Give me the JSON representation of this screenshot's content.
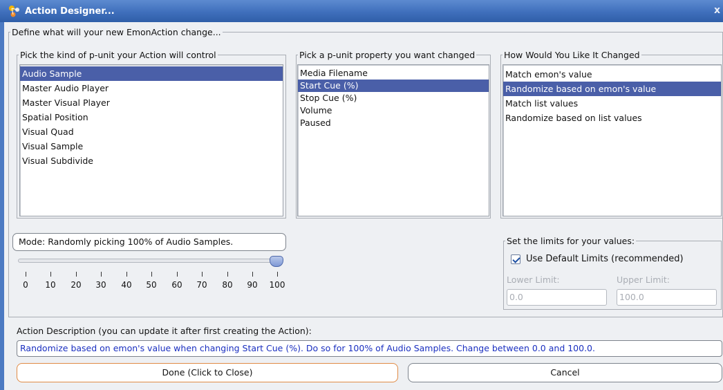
{
  "window": {
    "title": "Action Designer...",
    "close_label": "x"
  },
  "main_group": {
    "legend": "Define what will your new EmonAction change..."
  },
  "punit_kind": {
    "legend": "Pick the kind of p-unit your Action will control",
    "items": [
      "Audio Sample",
      "Master Audio Player",
      "Master Visual Player",
      "Spatial Position",
      "Visual Quad",
      "Visual Sample",
      "Visual Subdivide"
    ],
    "selected": "Audio Sample"
  },
  "punit_property": {
    "legend": "Pick a p-unit property you want changed",
    "items": [
      "Media Filename",
      "Start Cue (%)",
      "Stop Cue (%)",
      "Volume",
      "Paused"
    ],
    "selected": "Start Cue (%)"
  },
  "change_method": {
    "legend": "How Would You Like It Changed",
    "items": [
      "Match emon's value",
      "Randomize based on emon's value",
      "Match list values",
      "Randomize based on list values"
    ],
    "selected": "Randomize based on emon's value"
  },
  "mode": {
    "text": "Mode: Randomly picking 100% of Audio Samples.",
    "slider_value": 100,
    "slider_ticks": [
      "0",
      "10",
      "20",
      "30",
      "40",
      "50",
      "60",
      "70",
      "80",
      "90",
      "100"
    ]
  },
  "limits": {
    "legend": "Set the limits for your values:",
    "use_default_label": "Use Default Limits (recommended)",
    "use_default_checked": true,
    "lower_label": "Lower Limit:",
    "upper_label": "Upper Limit:",
    "lower_value": "0.0",
    "upper_value": "100.0"
  },
  "description": {
    "label": "Action Description (you can update it after first creating the Action):",
    "value": "Randomize based on emon's value when changing Start Cue (%). Do so for 100% of Audio Samples. Change between 0.0 and 100.0."
  },
  "buttons": {
    "done": "Done (Click to Close)",
    "cancel": "Cancel"
  },
  "colors": {
    "titlebar": "#3f6fbc",
    "selection": "#4a5fa8",
    "description_text": "#1a2fc0",
    "done_border": "#e08a44"
  }
}
